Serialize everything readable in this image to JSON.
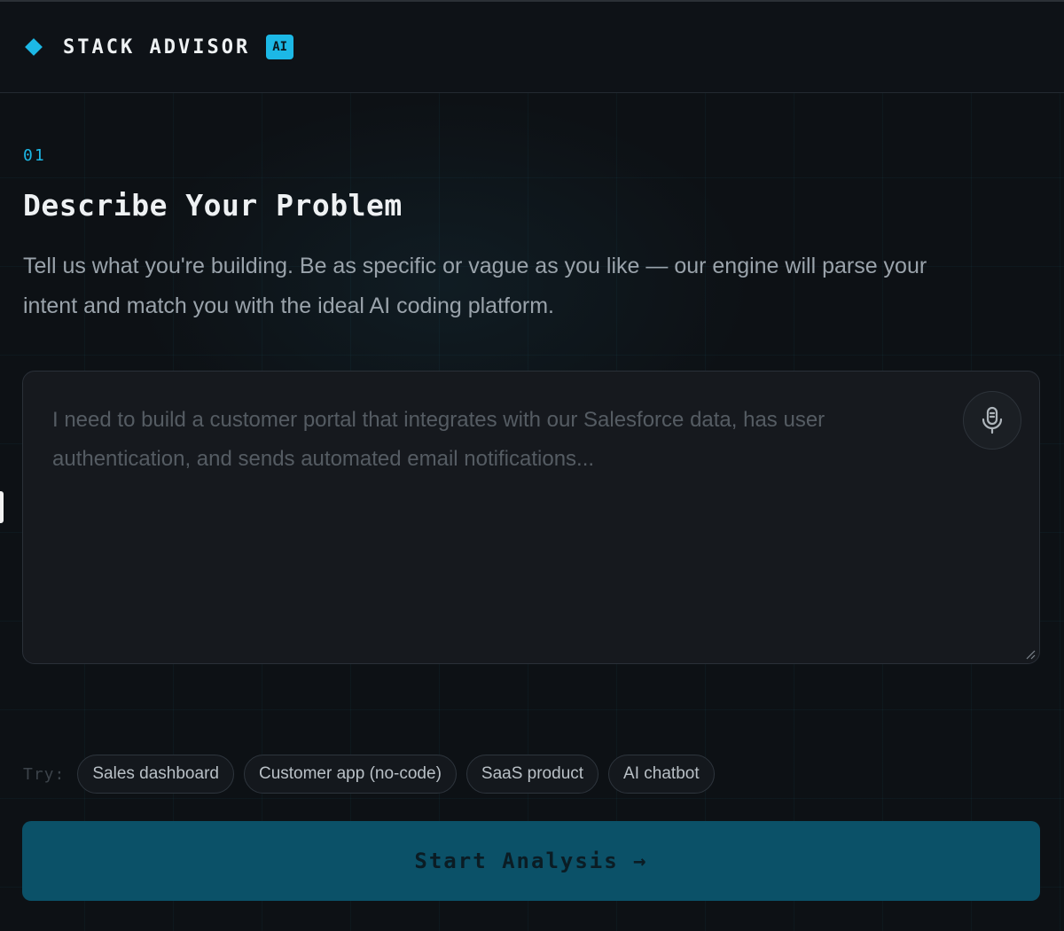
{
  "header": {
    "brand": "STACK ADVISOR",
    "badge": "AI",
    "logo_icon": "diamond-icon"
  },
  "step": {
    "number": "01",
    "title": "Describe Your Problem",
    "description": "Tell us what you're building. Be as specific or vague as you like — our engine will parse your intent and match you with the ideal AI coding platform."
  },
  "input": {
    "value": "",
    "placeholder": "I need to build a customer portal that integrates with our Salesforce data, has user authentication, and sends automated email notifications...",
    "mic_icon": "microphone-icon"
  },
  "suggestions": {
    "label": "Try:",
    "chips": [
      "Sales dashboard",
      "Customer app (no-code)",
      "SaaS product",
      "AI chatbot"
    ]
  },
  "cta": {
    "label": "Start Analysis →"
  },
  "colors": {
    "accent": "#1cb8e6",
    "background": "#0d1115",
    "button": "#0b5168"
  }
}
